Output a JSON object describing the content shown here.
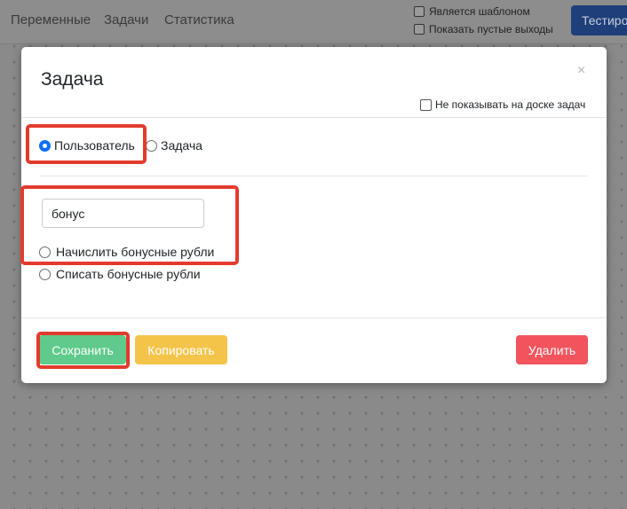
{
  "nav": {
    "links": [
      "Переменные",
      "Задачи",
      "Статистика"
    ],
    "checkboxes": [
      "Является шаблоном",
      "Показать пустые выходы"
    ],
    "test_button": "Тестиро"
  },
  "modal": {
    "title": "Задача",
    "close": "×",
    "hide_from_board": "Не показывать на доске задач",
    "type_options": [
      {
        "label": "Пользователь",
        "selected": true
      },
      {
        "label": "Задача",
        "selected": false
      }
    ],
    "input_value": "бонус",
    "action_options": [
      {
        "label": "Начислить бонусные рубли",
        "selected": false
      },
      {
        "label": "Списать бонусные рубли",
        "selected": false
      }
    ],
    "buttons": {
      "save": "Сохранить",
      "copy": "Копировать",
      "delete": "Удалить"
    }
  },
  "colors": {
    "save": "#5fca8b",
    "copy": "#f4c44a",
    "delete": "#f2545d",
    "radio_selected": "#0d6efd",
    "highlight": "#e23b2e"
  }
}
